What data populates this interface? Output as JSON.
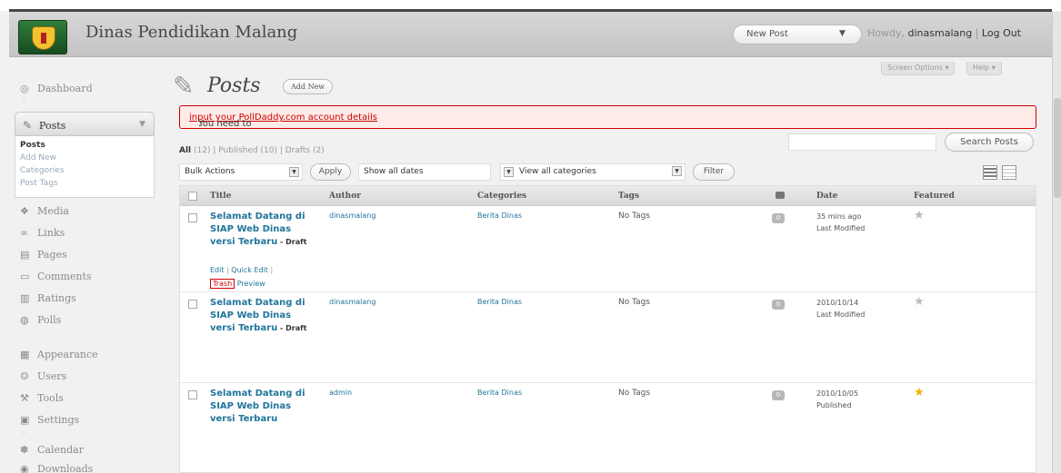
{
  "header": {
    "site_title": "Dinas Pendidikan Malang",
    "new_post": "New Post",
    "howdy": "Howdy,",
    "username": "dinasmalang",
    "separator": "|",
    "logout": "Log Out"
  },
  "top_links": {
    "screen_options": "Screen Options ▾",
    "help": "Help ▾"
  },
  "sidebar": {
    "dashboard": "Dashboard",
    "posts": "Posts",
    "submenu": [
      "Posts",
      "Add New",
      "Categories",
      "Post Tags"
    ],
    "items": [
      "Media",
      "Links",
      "Pages",
      "Comments",
      "Ratings",
      "Polls"
    ],
    "items2": [
      "Appearance",
      "Users",
      "Tools",
      "Settings"
    ],
    "items3": [
      "Calendar",
      "Downloads"
    ]
  },
  "page": {
    "title": "Posts",
    "add_new": "Add New"
  },
  "notice": {
    "prefix": "You need to ",
    "link": "input your PollDaddy.com account details",
    "suffix": "."
  },
  "filters": {
    "all": "All",
    "all_count": "(12)",
    "published": "Published",
    "published_count": "(10)",
    "drafts": "Drafts",
    "drafts_count": "(2)",
    "bulk": "Bulk Actions",
    "apply": "Apply",
    "dates": "Show all dates",
    "categories": "View all categories",
    "filter": "Filter",
    "search_button": "Search Posts",
    "search_value": ""
  },
  "table": {
    "headers": {
      "title": "Title",
      "author": "Author",
      "categories": "Categories",
      "tags": "Tags",
      "date": "Date",
      "featured": "Featured"
    },
    "rows": [
      {
        "title": "Selamat Datang di SIAP Web Dinas versi Terbaru",
        "state": " - Draft",
        "author": "dinasmalang",
        "categories": "Berita Dinas",
        "tags": "No Tags",
        "comments": "0",
        "date": "35 mins ago",
        "status": "Last Modified",
        "featured": false,
        "actions": {
          "edit": "Edit",
          "quick_edit": "Quick Edit",
          "trash": "Trash",
          "preview": "Preview"
        }
      },
      {
        "title": "Selamat Datang di SIAP Web Dinas versi Terbaru",
        "state": " - Draft",
        "author": "dinasmalang",
        "categories": "Berita Dinas",
        "tags": "No Tags",
        "comments": "0",
        "date": "2010/10/14",
        "status": "Last Modified",
        "featured": false
      },
      {
        "title": "Selamat Datang di SIAP Web Dinas versi Terbaru",
        "state": "",
        "author": "admin",
        "categories": "Berita Dinas",
        "tags": "No Tags",
        "comments": "0",
        "date": "2010/10/05",
        "status": "Published",
        "featured": true
      }
    ]
  },
  "colors": {
    "accent_link": "#21759b",
    "notice_border": "#cc0000",
    "featured_star": "#f0b400"
  }
}
